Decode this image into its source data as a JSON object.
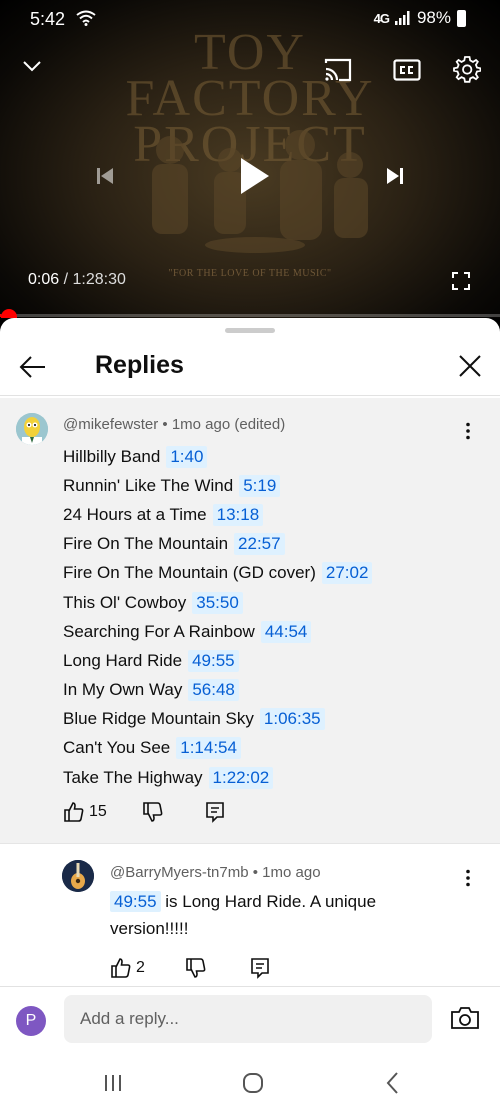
{
  "status_bar": {
    "time": "5:42",
    "network": "4G",
    "signal_text": "",
    "battery": "98%"
  },
  "video": {
    "artwork_title": "TOY FACTORY PROJECT",
    "artwork_caption": "\"FOR THE LOVE OF THE MUSIC\"",
    "current_time": "0:06",
    "separator": " / ",
    "duration": "1:28:30",
    "progress_fraction": 0.0011
  },
  "sheet": {
    "title": "Replies",
    "parent_comment": {
      "meta": "@mikefewster • 1mo ago (edited)",
      "tracks": [
        {
          "name": "Hillbilly Band",
          "time": "1:40"
        },
        {
          "name": "Runnin' Like The Wind",
          "time": "5:19"
        },
        {
          "name": "24 Hours at a Time",
          "time": "13:18"
        },
        {
          "name": "Fire On The Mountain",
          "time": "22:57"
        },
        {
          "name": "Fire On The Mountain (GD cover)",
          "time": "27:02"
        },
        {
          "name": "This Ol' Cowboy",
          "time": "35:50"
        },
        {
          "name": "Searching For A Rainbow",
          "time": "44:54"
        },
        {
          "name": "Long Hard Ride",
          "time": "49:55"
        },
        {
          "name": "In My Own Way",
          "time": "56:48"
        },
        {
          "name": "Blue Ridge Mountain Sky",
          "time": "1:06:35"
        },
        {
          "name": "Can't You See",
          "time": "1:14:54"
        },
        {
          "name": "Take The Highway",
          "time": "1:22:02"
        }
      ],
      "likes": "15"
    },
    "reply": {
      "meta": "@BarryMyers-tn7mb • 1mo ago",
      "timestamp": "49:55",
      "text": " is Long Hard Ride.  A unique version!!!!!",
      "likes": "2"
    },
    "composer": {
      "avatar_letter": "P",
      "placeholder": "Add a reply..."
    }
  },
  "colors": {
    "link": "#065fd4",
    "link_bg": "#def1ff",
    "progress": "#ff0000",
    "composer_avatar": "#7e57c2"
  }
}
